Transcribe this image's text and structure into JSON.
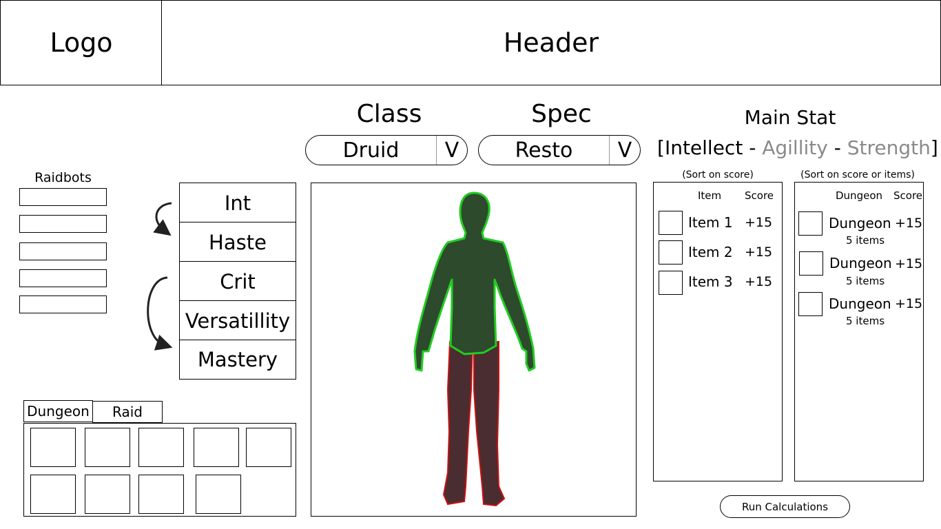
{
  "header": {
    "logo": "Logo",
    "title": "Header"
  },
  "class_select": {
    "title": "Class",
    "value": "Druid",
    "arrow": "V"
  },
  "spec_select": {
    "title": "Spec",
    "value": "Resto",
    "arrow": "V"
  },
  "main_stat": {
    "title": "Main Stat",
    "open": "[",
    "primary": "Intellect",
    "sep1": " - ",
    "second": "Agillity",
    "sep2": " - ",
    "third": "Strength",
    "close": "]"
  },
  "raidbots": {
    "label": "Raidbots",
    "input_count": 5
  },
  "stats": [
    "Int",
    "Haste",
    "Crit",
    "Versatillity",
    "Mastery"
  ],
  "tabs": {
    "dungeon": "Dungeon",
    "raid": "Raid"
  },
  "items_table": {
    "sort_label": "(Sort on score)",
    "headers": {
      "item": "Item",
      "score": "Score"
    },
    "rows": [
      {
        "name": "Item 1",
        "score": "+15"
      },
      {
        "name": "Item 2",
        "score": "+15"
      },
      {
        "name": "Item 3",
        "score": "+15"
      }
    ]
  },
  "dungeon_table": {
    "sort_label": "(Sort on score or items)",
    "headers": {
      "dungeon": "Dungeon",
      "score": "Score"
    },
    "rows": [
      {
        "name": "Dungeon",
        "score": "+15",
        "sub": "5 items"
      },
      {
        "name": "Dungeon",
        "score": "+15",
        "sub": "5 items"
      },
      {
        "name": "Dungeon",
        "score": "+15",
        "sub": "5 items"
      }
    ]
  },
  "run_button": "Run Calculations",
  "colors": {
    "body_fill": "#2d4a2d",
    "body_outline": "#22cc22",
    "legs_fill": "#4a2d30",
    "legs_outline": "#cc1111",
    "muted_text": "#8a8a8a"
  }
}
